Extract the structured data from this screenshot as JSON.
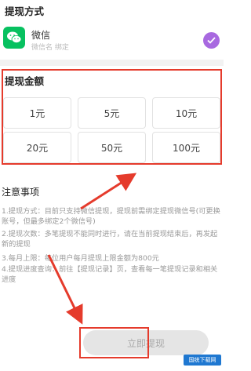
{
  "withdraw_method": {
    "title": "提现方式",
    "account_name": "微信",
    "account_sub": "微信名    绑定"
  },
  "withdraw_amount": {
    "title": "提现金额",
    "options": [
      "1元",
      "5元",
      "10元",
      "20元",
      "50元",
      "100元"
    ]
  },
  "notes": {
    "title": "注意事项",
    "items": [
      "1.提现方式：目前只支持微信提现，提现前需绑定提现微信号(可更换账号，但最多绑定2个微信号)",
      "2.提现次数：多笔提现不能同时进行，请在当前提现结束后，再发起新的提现",
      "3.每月上限：每位用户每月提现上限金额为800元",
      "4.提现进度查询：前往【提现记录】页，查看每一笔提现记录和相关进度"
    ]
  },
  "submit": {
    "label": "立即提现"
  },
  "watermark": {
    "text": "国统下载网"
  },
  "colors": {
    "accent": "#a869e0",
    "wechat": "#07c160",
    "annotation_red": "#e53b2c"
  },
  "icons": {
    "wechat": "wechat-icon",
    "check": "check-icon"
  }
}
